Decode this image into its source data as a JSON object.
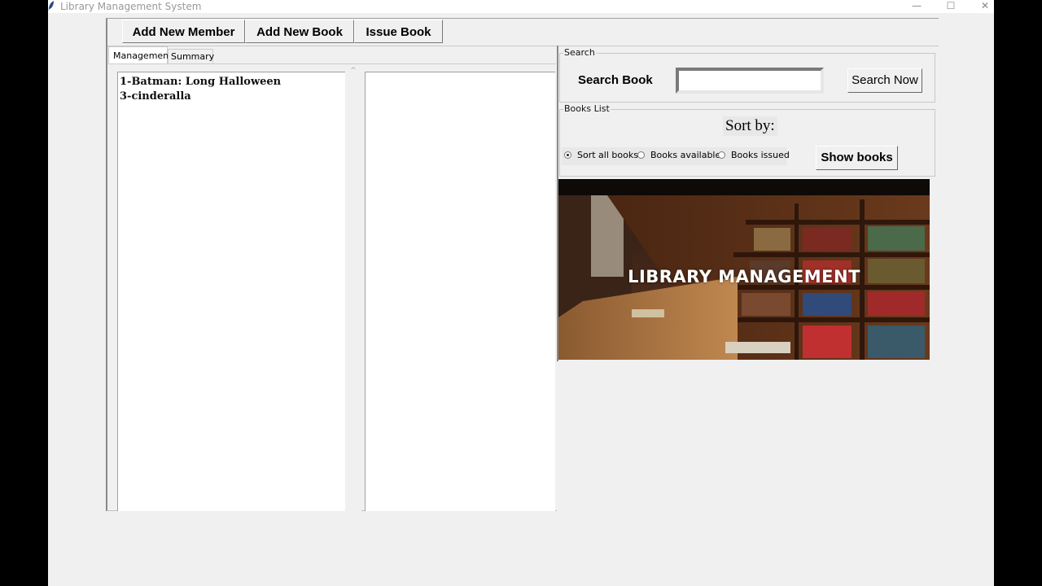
{
  "window": {
    "title": "Library Management System",
    "controls": {
      "minimize": "—",
      "maximize": "☐",
      "close": "✕"
    }
  },
  "toolbar": {
    "add_member_label": "Add New Member",
    "add_book_label": "Add New Book",
    "issue_book_label": "Issue Book"
  },
  "tabs": [
    {
      "label": "Management",
      "active": true
    },
    {
      "label": "Summary",
      "active": false
    }
  ],
  "books_listbox": {
    "items": [
      "1-Batman: Long Halloween",
      "3-cinderalla"
    ]
  },
  "search": {
    "group_label": "Search",
    "search_book_label": "Search Book",
    "input_value": "",
    "button_label": "Search Now"
  },
  "books_list": {
    "group_label": "Books List",
    "sort_by_label": "Sort by:",
    "options": [
      {
        "label": "Sort all books",
        "selected": true
      },
      {
        "label": "Books available",
        "selected": false
      },
      {
        "label": "Books issued",
        "selected": false
      }
    ],
    "show_books_label": "Show books"
  },
  "banner": {
    "text": "LIBRARY MANAGEMENT"
  },
  "colors": {
    "window_bg": "#f0f0f0",
    "outer_bg": "#000000",
    "listbox_bg": "#ffffff",
    "title_text": "#999999"
  }
}
